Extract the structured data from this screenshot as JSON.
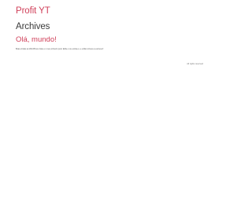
{
  "header": {
    "site_title": "Profit YT"
  },
  "main": {
    "archive_heading": "Archives",
    "posts": [
      {
        "title": "Olá, mundo!",
        "excerpt": "Boas-vindas ao WordPress. Esse é o seu primeiro post. Edite-o ou exclua-o, e então comece a escrever!"
      }
    ]
  },
  "footer": {
    "rights": "All rights reserved"
  },
  "colors": {
    "accent": "#d0405a",
    "heading": "#3a3a3a",
    "text": "#555555"
  }
}
